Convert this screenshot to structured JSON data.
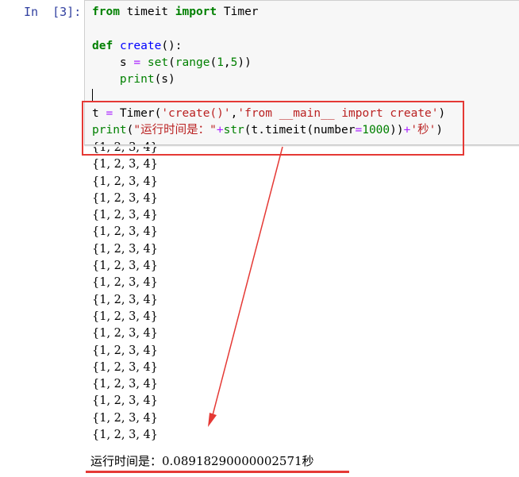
{
  "cell": {
    "prompt": "In  [3]:",
    "code": {
      "l1": {
        "k1": "from",
        "t1": " timeit ",
        "k2": "import",
        "t2": " Timer"
      },
      "l3": {
        "k1": "def",
        "sp": " ",
        "fn": "create",
        "rest": "():"
      },
      "l4": {
        "indent": "    s ",
        "eq": "=",
        "sp": " ",
        "fn1": "set",
        "p1": "(",
        "fn2": "range",
        "p2": "(",
        "n1": "1",
        "c": ",",
        "n2": "5",
        "p3": "))"
      },
      "l5": {
        "indent": "    ",
        "fn": "print",
        "rest": "(s)"
      },
      "l7": {
        "t1": "t ",
        "eq": "=",
        "t2": " Timer(",
        "s1": "'create()'",
        "c": ",",
        "s2": "'from __main__ import create'",
        "t3": ")"
      },
      "l8": {
        "fn1": "print",
        "p1": "(",
        "s1": "\"运行时间是：\"",
        "op1": "+",
        "fn2": "str",
        "t2": "(t.timeit(number",
        "eq": "=",
        "n": "1000",
        "t3": "))",
        "op2": "+",
        "s2": "'秒'",
        "t4": ")"
      }
    }
  },
  "output": {
    "rows": [
      "{1, 2, 3, 4}",
      "{1, 2, 3, 4}",
      "{1, 2, 3, 4}",
      "{1, 2, 3, 4}",
      "{1, 2, 3, 4}",
      "{1, 2, 3, 4}",
      "{1, 2, 3, 4}",
      "{1, 2, 3, 4}",
      "{1, 2, 3, 4}",
      "{1, 2, 3, 4}",
      "{1, 2, 3, 4}",
      "{1, 2, 3, 4}",
      "{1, 2, 3, 4}",
      "{1, 2, 3, 4}",
      "{1, 2, 3, 4}",
      "{1, 2, 3, 4}",
      "{1, 2, 3, 4}",
      "{1, 2, 3, 4}"
    ],
    "result": "运行时间是：0.08918290000002571秒"
  },
  "colors": {
    "annotation": "#e53935",
    "prompt": "#303f9f",
    "keyword": "#008000",
    "function": "#0000ff",
    "string": "#ba2121"
  }
}
